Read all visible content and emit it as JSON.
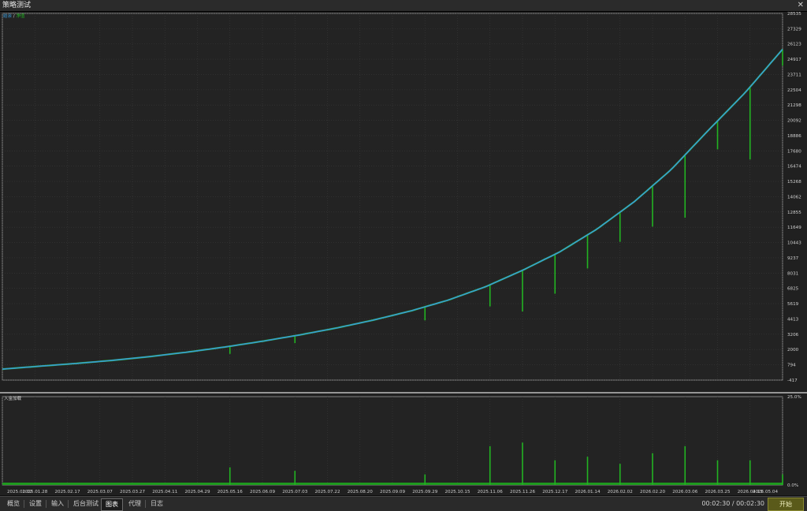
{
  "window": {
    "title": "策略测试"
  },
  "legend": {
    "balance": "结余",
    "slash": " / ",
    "equity": "净值",
    "balance_color": "#3a9ad9",
    "equity_color": "#22b322"
  },
  "deposit_label": "入金加载",
  "tabs": [
    "概览",
    "设置",
    "输入",
    "后台测试",
    "图表",
    "代理",
    "日志"
  ],
  "active_tab": "图表",
  "timer": "00:02:30 / 00:02:30",
  "start_button": "开始",
  "chart_data": [
    {
      "type": "line",
      "series": [
        {
          "name": "结余",
          "color": "#3a9ad9"
        },
        {
          "name": "净值",
          "color": "#22b322"
        }
      ],
      "y_ticks": [
        -417,
        794,
        2000,
        3206,
        4413,
        5619,
        6825,
        8031,
        9237,
        10443,
        11649,
        12855,
        14062,
        15268,
        16474,
        17680,
        18886,
        20092,
        21298,
        22504,
        23711,
        24917,
        26123,
        27329,
        28535
      ],
      "ylim": [
        -417,
        28535
      ],
      "x_ticks": [
        "2025.01.02",
        "2025.01.28",
        "2025.02.17",
        "2025.03.07",
        "2025.03.27",
        "2025.04.11",
        "2025.04.29",
        "2025.05.16",
        "2025.06.09",
        "2025.07.03",
        "2025.07.22",
        "2025.08.20",
        "2025.09.09",
        "2025.09.29",
        "2025.10.15",
        "2025.11.06",
        "2025.11.26",
        "2025.12.17",
        "2026.01.14",
        "2026.02.02",
        "2026.02.20",
        "2026.03.06",
        "2026.03.25",
        "2026.04.13",
        "2026.05.04"
      ],
      "balance_values": [
        450,
        680,
        900,
        1150,
        1450,
        1800,
        2200,
        2650,
        3150,
        3700,
        4330,
        5050,
        5900,
        6950,
        8250,
        9700,
        11500,
        13650,
        16200,
        19300,
        22300,
        25700
      ],
      "equity_drops": [
        {
          "x": "2025.05.16",
          "value": 1650
        },
        {
          "x": "2025.07.03",
          "value": 2500
        },
        {
          "x": "2025.09.29",
          "value": 4300
        },
        {
          "x": "2025.11.06",
          "value": 5400
        },
        {
          "x": "2025.11.26",
          "value": 5000
        },
        {
          "x": "2025.12.17",
          "value": 6400
        },
        {
          "x": "2026.01.14",
          "value": 8400
        },
        {
          "x": "2026.02.02",
          "value": 10500
        },
        {
          "x": "2026.02.20",
          "value": 11700
        },
        {
          "x": "2026.03.06",
          "value": 12400
        },
        {
          "x": "2026.03.25",
          "value": 17800
        },
        {
          "x": "2026.04.13",
          "value": 17000
        },
        {
          "x": "2026.05.04",
          "value": 24400
        }
      ],
      "grid": true,
      "legend_position": "top-left"
    },
    {
      "type": "bar",
      "ylim": [
        0,
        25
      ],
      "y_ticks": [
        "25.0%",
        "0.0%"
      ],
      "spikes": [
        {
          "x": "2025.05.16",
          "value": 5
        },
        {
          "x": "2025.07.03",
          "value": 4
        },
        {
          "x": "2025.09.29",
          "value": 3
        },
        {
          "x": "2025.11.06",
          "value": 11
        },
        {
          "x": "2025.11.26",
          "value": 12
        },
        {
          "x": "2025.12.17",
          "value": 7
        },
        {
          "x": "2026.01.14",
          "value": 8
        },
        {
          "x": "2026.02.02",
          "value": 6
        },
        {
          "x": "2026.02.20",
          "value": 9
        },
        {
          "x": "2026.03.06",
          "value": 11
        },
        {
          "x": "2026.03.25",
          "value": 7
        },
        {
          "x": "2026.04.13",
          "value": 7
        },
        {
          "x": "2026.05.04",
          "value": 3
        }
      ],
      "grid": true
    }
  ]
}
